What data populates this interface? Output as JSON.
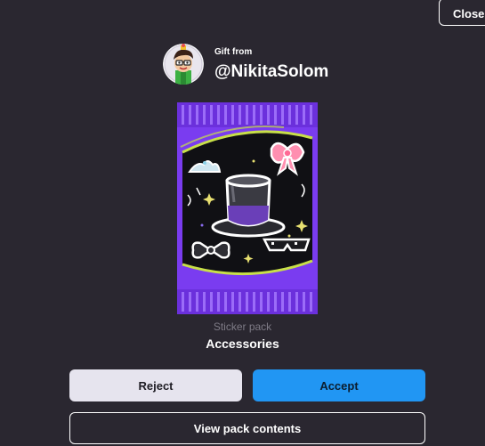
{
  "dialog": {
    "close_label": "Close"
  },
  "sender": {
    "caption": "Gift from",
    "username": "@NikitaSolom",
    "avatar_icon": "cartoon-character-avatar"
  },
  "pack": {
    "type": "Sticker pack",
    "name": "Accessories",
    "art_icons": [
      "top-hat-icon",
      "bow-tie-icon",
      "pink-bow-icon",
      "sunglasses-icon",
      "tiara-icon"
    ]
  },
  "actions": {
    "reject_label": "Reject",
    "accept_label": "Accept",
    "view_label": "View pack contents"
  },
  "colors": {
    "background": "#2a2730",
    "accept": "#2196f3",
    "reject": "#e6e4ee",
    "pack_purple": "#7a3cf0"
  }
}
